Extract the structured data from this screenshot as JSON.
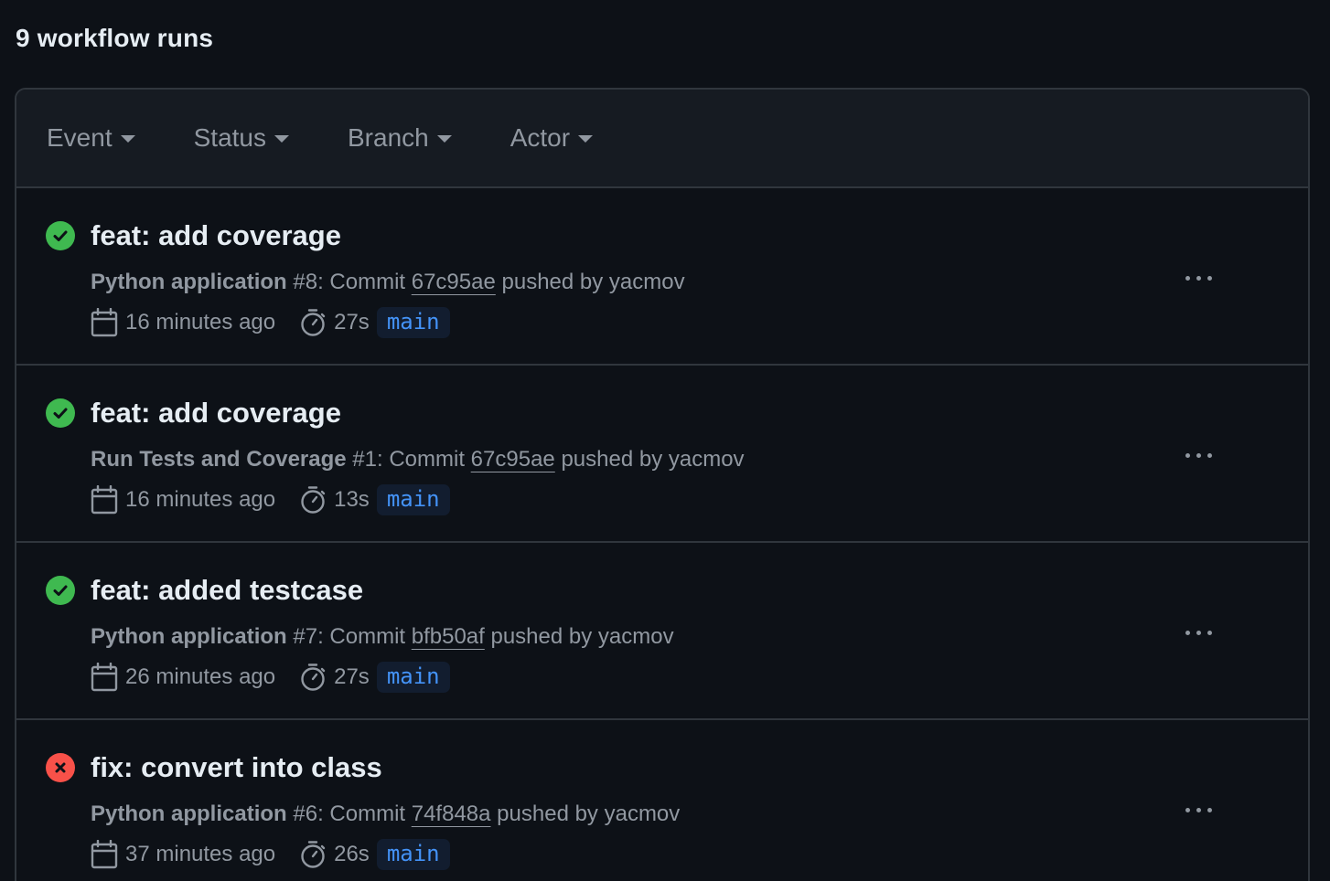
{
  "header": {
    "title": "9 workflow runs"
  },
  "filters": [
    {
      "label": "Event"
    },
    {
      "label": "Status"
    },
    {
      "label": "Branch"
    },
    {
      "label": "Actor"
    }
  ],
  "runs": [
    {
      "status": "success",
      "title": "feat: add coverage",
      "workflow": "Python application",
      "number": "#8",
      "commit_prefix": ": Commit",
      "sha": "67c95ae",
      "pushed_by": "pushed by yacmov",
      "time": "16 minutes ago",
      "duration": "27s",
      "branch": "main"
    },
    {
      "status": "success",
      "title": "feat: add coverage",
      "workflow": "Run Tests and Coverage",
      "number": "#1",
      "commit_prefix": ": Commit",
      "sha": "67c95ae",
      "pushed_by": "pushed by yacmov",
      "time": "16 minutes ago",
      "duration": "13s",
      "branch": "main"
    },
    {
      "status": "success",
      "title": "feat: added testcase",
      "workflow": "Python application",
      "number": "#7",
      "commit_prefix": ": Commit",
      "sha": "bfb50af",
      "pushed_by": "pushed by yacmov",
      "time": "26 minutes ago",
      "duration": "27s",
      "branch": "main"
    },
    {
      "status": "failure",
      "title": "fix: convert into class",
      "workflow": "Python application",
      "number": "#6",
      "commit_prefix": ": Commit",
      "sha": "74f848a",
      "pushed_by": "pushed by yacmov",
      "time": "37 minutes ago",
      "duration": "26s",
      "branch": "main"
    }
  ],
  "colors": {
    "background": "#0d1117",
    "success": "#3fb950",
    "failure": "#f85149",
    "branch_text": "#4493f8",
    "muted": "#9198a1"
  },
  "icons": {
    "success": "check-circle-icon",
    "failure": "x-circle-icon",
    "date": "calendar-icon",
    "duration": "stopwatch-icon",
    "more": "kebab-horizontal-icon",
    "filter_caret": "triangle-down-icon"
  }
}
